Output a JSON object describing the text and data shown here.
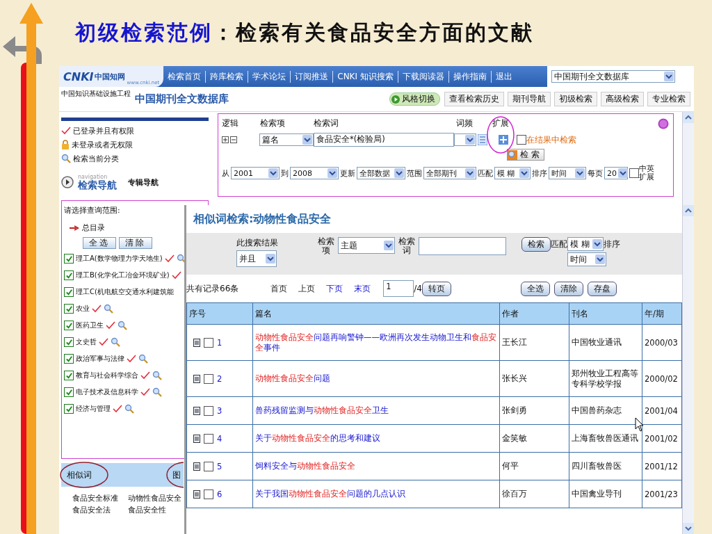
{
  "slide": {
    "title_lead": "初级检索范例",
    "title_rest": "：检索有关食品安全方面的文献"
  },
  "header": {
    "logo_mark": "CNKI",
    "logo_name": "中国知网",
    "logo_url": "www.cnki.net",
    "nav_links": [
      "检索首页",
      "跨库检索",
      "学术论坛",
      "订阅推送",
      "CNKI 知识搜索",
      "下载阅读器",
      "操作指南",
      "退出"
    ],
    "database_select": "中国期刊全文数据库"
  },
  "subheader": {
    "caption": "中国知识基础设施工程",
    "database_title": "中国期刊全文数据库",
    "style_button": "风格切换",
    "tools": [
      "查看检索历史",
      "期刊导航",
      "初级检索",
      "高级检索",
      "专业检索"
    ]
  },
  "legend": [
    {
      "kind": "check",
      "text": "已登录并且有权限"
    },
    {
      "kind": "lock",
      "text": "未登录或者无权限"
    },
    {
      "kind": "search",
      "text": "检索当前分类"
    }
  ],
  "navigation": {
    "caption": "navigation",
    "title": "检索导航",
    "alt_link": "专辑导航"
  },
  "scope": {
    "prompt": "请选择查询范围:",
    "root": "总目录",
    "buttons": [
      "全选",
      "清除"
    ],
    "categories": [
      {
        "label": "理工A(数学物理力学天地生)",
        "checked": true,
        "access": true,
        "search": true
      },
      {
        "label": "理工B(化学化工冶金环境矿业)",
        "checked": true,
        "access": true,
        "search": false
      },
      {
        "label": "理工C(机电航空交通水利建筑能",
        "checked": true,
        "access": false,
        "search": false
      },
      {
        "label": "农业",
        "checked": true,
        "access": true,
        "search": true
      },
      {
        "label": "医药卫生",
        "checked": true,
        "access": true,
        "search": true
      },
      {
        "label": "文史哲",
        "checked": true,
        "access": true,
        "search": true
      },
      {
        "label": "政治军事与法律",
        "checked": true,
        "access": true,
        "search": true
      },
      {
        "label": "教育与社会科学综合",
        "checked": true,
        "access": true,
        "search": true
      },
      {
        "label": "电子技术及信息科学",
        "checked": true,
        "access": true,
        "search": true
      },
      {
        "label": "经济与管理",
        "checked": true,
        "access": true,
        "search": true
      }
    ]
  },
  "similar_tabs": [
    "相似词",
    "图"
  ],
  "similar_words": [
    "食品安全标准",
    "动物性食品安全",
    "食品安全法",
    "食品安全性"
  ],
  "search_form": {
    "headers": [
      "逻辑",
      "检索项",
      "检索词",
      "词频",
      "扩展"
    ],
    "field": "篇名",
    "term": "食品安全*(检验局)",
    "in_results": {
      "label": "在结果中检索",
      "checked": false
    },
    "search_button": "检 索",
    "filters": [
      {
        "label": "从",
        "value": "2001"
      },
      {
        "label": "到",
        "value": "2008"
      },
      {
        "label": "更新",
        "value": "全部数据"
      },
      {
        "label": "范围",
        "value": "全部期刊"
      },
      {
        "label": "匹配",
        "value": "模 糊"
      },
      {
        "label": "排序",
        "value": "时间"
      },
      {
        "label": "每页",
        "value": "20"
      }
    ],
    "bilingual": {
      "label": "中英扩展",
      "checked": false
    }
  },
  "popup": {
    "title": "相似词检索:动物性食品安全",
    "combine_label": "此搜索结果",
    "combine": "并且",
    "field_label": "检索项",
    "field": "主题",
    "term_label": "检索词",
    "search_button": "检索",
    "match_label": "匹配",
    "match": "模 糊",
    "sort_label": "排序",
    "sort": "时间",
    "record_count": "共有记录66条",
    "pager": [
      {
        "label": "首页",
        "disabled": true
      },
      {
        "label": "上页",
        "disabled": true
      },
      {
        "label": "下页",
        "disabled": false
      },
      {
        "label": "末页",
        "disabled": false
      }
    ],
    "page": "1",
    "page_total": "/4",
    "go_button": "转页",
    "actions": [
      "全选",
      "清除",
      "存盘"
    ]
  },
  "table": {
    "columns": [
      "序号",
      "篇名",
      "作者",
      "刊名",
      "年/期"
    ],
    "rows": [
      {
        "no": "1",
        "checked": false,
        "title": [
          {
            "text": "动物性食品安全",
            "highlight": true
          },
          {
            "text": "问题再响警钟——欧洲再次发生动物卫生和",
            "highlight": false
          },
          {
            "text": "食品安全",
            "highlight": true
          },
          {
            "text": "事件",
            "highlight": false
          }
        ],
        "author": "王长江",
        "journal": "中国牧业通讯",
        "issue": "2000/03"
      },
      {
        "no": "2",
        "checked": false,
        "title": [
          {
            "text": "动物性食品安全",
            "highlight": true
          },
          {
            "text": "问题",
            "highlight": false
          }
        ],
        "author": "张长兴",
        "journal": "郑州牧业工程高等专科学校学报",
        "issue": "2000/02"
      },
      {
        "no": "3",
        "checked": false,
        "title": [
          {
            "text": "兽药残留监测与",
            "highlight": false
          },
          {
            "text": "动物性食品安全",
            "highlight": true
          },
          {
            "text": "卫生",
            "highlight": false
          }
        ],
        "author": "张剑勇",
        "journal": "中国兽药杂志",
        "issue": "2001/04"
      },
      {
        "no": "4",
        "checked": false,
        "title": [
          {
            "text": "关于",
            "highlight": false
          },
          {
            "text": "动物性食品安全",
            "highlight": true
          },
          {
            "text": "的思考和建议",
            "highlight": false
          }
        ],
        "author": "金笑敏",
        "journal": "上海畜牧兽医通讯",
        "issue": "2001/02"
      },
      {
        "no": "5",
        "checked": false,
        "title": [
          {
            "text": "饲料安全与",
            "highlight": false
          },
          {
            "text": "动物性食品安全",
            "highlight": true
          }
        ],
        "author": "何平",
        "journal": "四川畜牧兽医",
        "issue": "2001/12"
      },
      {
        "no": "6",
        "checked": false,
        "title": [
          {
            "text": "关于我国",
            "highlight": false
          },
          {
            "text": "动物性食品安全",
            "highlight": true
          },
          {
            "text": "问题的几点认识",
            "highlight": false
          }
        ],
        "author": "徐百万",
        "journal": "中国禽业导刊",
        "issue": "2001/23"
      }
    ]
  }
}
